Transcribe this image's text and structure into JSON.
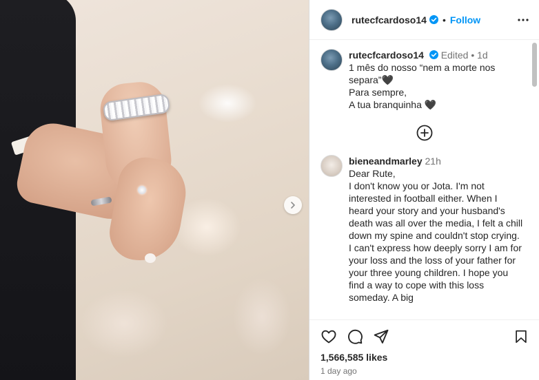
{
  "post": {
    "username": "rutecfcardoso14",
    "follow_label": "Follow",
    "separator": "•",
    "icons": {
      "more": "more-options-icon",
      "verified": "verified-badge-icon",
      "next": "chevron-right-icon"
    }
  },
  "caption": {
    "username": "rutecfcardoso14",
    "edited": "Edited",
    "separator": "•",
    "age": "1d",
    "lines": [
      "1 mês do nosso “nem a morte nos separa”🖤",
      "Para sempre,",
      "A tua branquinha 🖤"
    ]
  },
  "add_comments_icon": "plus-circle-icon",
  "comments": [
    {
      "username": "bieneandmarley",
      "age": "21h",
      "lines": [
        "Dear Rute,",
        "I don't know you or Jota. I'm not interested in football either. When I heard your story and your husband's death was all over the media, I felt a chill down my spine and couldn't stop crying. I can't express how deeply sorry I am for your loss and the loss of your father for your three young children. I hope you find a way to cope with this loss someday. A big"
      ]
    }
  ],
  "actions": {
    "icons": [
      "heart-icon",
      "comment-icon",
      "share-icon",
      "bookmark-icon"
    ],
    "likes": "1,566,585 likes",
    "time": "1 day ago"
  },
  "colors": {
    "link": "#0095f6",
    "verified": "#0095f6",
    "muted": "#737373",
    "text": "#262626"
  }
}
